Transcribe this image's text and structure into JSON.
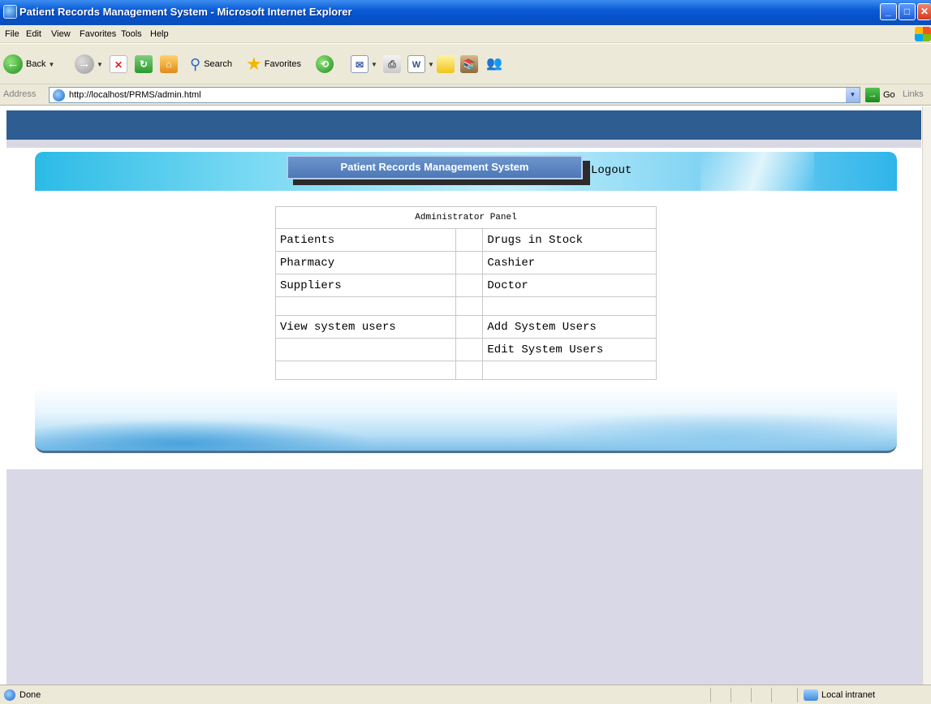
{
  "window": {
    "title": "Patient Records Management System - Microsoft Internet Explorer",
    "min": "_",
    "max": "□",
    "close": "✕"
  },
  "menu": [
    "File",
    "Edit",
    "View",
    "Favorites",
    "Tools",
    "Help"
  ],
  "toolbar": {
    "back": "Back",
    "search": "Search",
    "favorites": "Favorites"
  },
  "address": {
    "label": "Address",
    "url": "http://localhost/PRMS/admin.html",
    "go": "Go",
    "links": "Links"
  },
  "page": {
    "system_title": "Patient Records Management System",
    "logout": "Logout",
    "panel_title": "Administrator Panel",
    "rows": [
      [
        "Patients",
        "",
        "Drugs in Stock"
      ],
      [
        "Pharmacy",
        "",
        "Cashier"
      ],
      [
        "Suppliers",
        "",
        "Doctor"
      ],
      [
        "",
        "",
        ""
      ],
      [
        "View system users",
        "",
        "Add System Users"
      ],
      [
        "",
        "",
        "Edit System Users"
      ],
      [
        "",
        "",
        ""
      ]
    ]
  },
  "status": {
    "text": "Done",
    "zone": "Local intranet"
  },
  "colors": {
    "header_band": "#2e5d92",
    "titlebar": "#0a5bd6",
    "page_bg_below": "#d9d8e6"
  }
}
